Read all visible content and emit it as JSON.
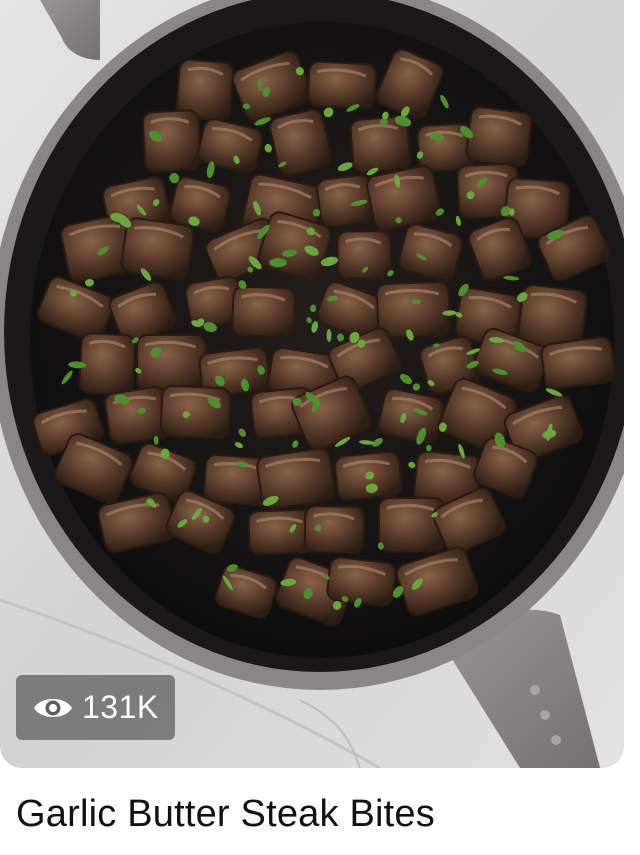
{
  "card": {
    "image_alt": "Garlic Butter Steak Bites",
    "views": {
      "icon": "eye-icon",
      "count": "131K"
    },
    "title": "Garlic Butter Steak Bites"
  },
  "colors": {
    "countertop": "#dcdcdc",
    "pan_rim": "#8a8587",
    "pan_interior": "#141213",
    "steak": "#5a3b2a",
    "parsley": "#4f8f2e",
    "badge_bg": "rgba(90,90,90,0.72)",
    "title_text": "#111111"
  }
}
